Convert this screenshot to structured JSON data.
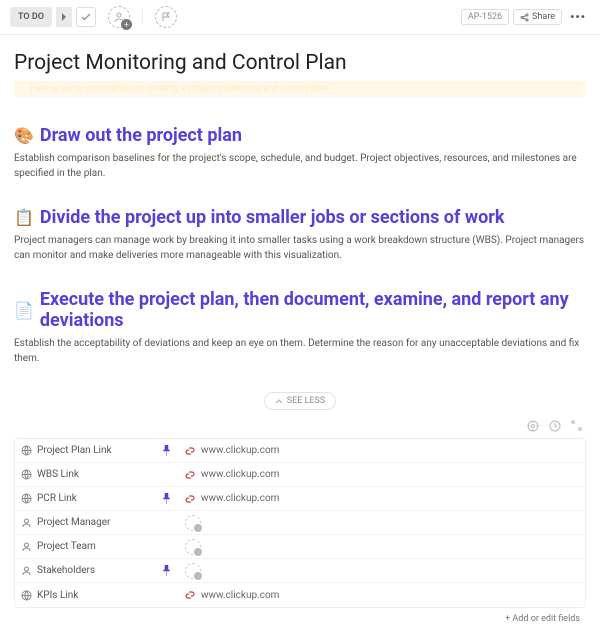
{
  "toolbar": {
    "status_label": "TO DO",
    "task_id": "AP-1526",
    "share_label": "Share"
  },
  "page": {
    "title": "Project Monitoring and Control Plan",
    "notice": "Here is some information on creating a project monitoring and control plan."
  },
  "sections": [
    {
      "emoji": "🎨",
      "title": "Draw out the project plan",
      "body": "Establish comparison baselines for the project's scope, schedule, and budget. Project objectives, resources, and milestones are specified in the plan."
    },
    {
      "emoji": "📋",
      "title": "Divide the project up into smaller jobs or sections of work",
      "body": "Project managers can manage work by breaking it into smaller tasks using a work breakdown structure (WBS). Project managers can monitor and make deliveries more manageable with this visualization."
    },
    {
      "emoji": "📄",
      "title": "Execute the project plan, then document, examine, and report any deviations",
      "body": "Establish the acceptability of deviations and keep an eye on them. Determine the reason for any unacceptable deviations and fix them."
    }
  ],
  "see_less_label": "SEE LESS",
  "fields": [
    {
      "icon": "globe",
      "label": "Project Plan Link",
      "pin": true,
      "type": "link",
      "value": "www.clickup.com"
    },
    {
      "icon": "globe",
      "label": "WBS Link",
      "pin": false,
      "type": "link",
      "value": "www.clickup.com"
    },
    {
      "icon": "globe",
      "label": "PCR Link",
      "pin": true,
      "type": "link",
      "value": "www.clickup.com"
    },
    {
      "icon": "person",
      "label": "Project Manager",
      "pin": false,
      "type": "person",
      "value": ""
    },
    {
      "icon": "person",
      "label": "Project Team",
      "pin": false,
      "type": "person",
      "value": ""
    },
    {
      "icon": "person",
      "label": "Stakeholders",
      "pin": true,
      "type": "person",
      "value": ""
    },
    {
      "icon": "globe",
      "label": "KPIs Link",
      "pin": false,
      "type": "link",
      "value": "www.clickup.com"
    }
  ],
  "add_fields_label": "+ Add or edit fields"
}
